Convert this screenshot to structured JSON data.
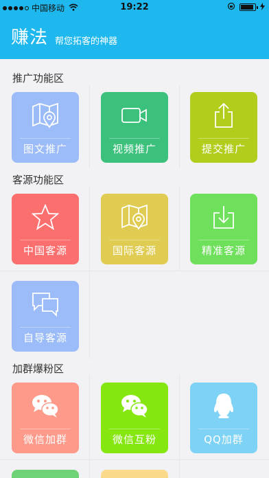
{
  "status_bar": {
    "carrier": "中国移动",
    "time": "19:22",
    "battery_level": 0.9
  },
  "header": {
    "title": "赚法",
    "subtitle": "帮您拓客的神器"
  },
  "sections": [
    {
      "title": "推广功能区",
      "items": [
        {
          "label": "图文推广",
          "icon": "map-pin-icon",
          "color": "#9bbcf8"
        },
        {
          "label": "视频推广",
          "icon": "video-camera-icon",
          "color": "#3cc17d"
        },
        {
          "label": "提交推广",
          "icon": "share-upload-icon",
          "color": "#b3cd1d"
        }
      ]
    },
    {
      "title": "客源功能区",
      "items": [
        {
          "label": "中国客源",
          "icon": "star-icon",
          "color": "#fc6f6f"
        },
        {
          "label": "国际客源",
          "icon": "map-pin-icon",
          "color": "#e0cc52"
        },
        {
          "label": "精准客源",
          "icon": "download-icon",
          "color": "#6fe05b"
        },
        {
          "label": "自导客源",
          "icon": "chat-bubbles-icon",
          "color": "#9bbcf8"
        }
      ]
    },
    {
      "title": "加群爆粉区",
      "items": [
        {
          "label": "微信加群",
          "icon": "wechat-icon",
          "color": "#fd9a8a"
        },
        {
          "label": "微信互粉",
          "icon": "wechat-icon",
          "color": "#86e60f"
        },
        {
          "label": "QQ加群",
          "icon": "qq-penguin-icon",
          "color": "#7dd2f5"
        }
      ]
    }
  ]
}
